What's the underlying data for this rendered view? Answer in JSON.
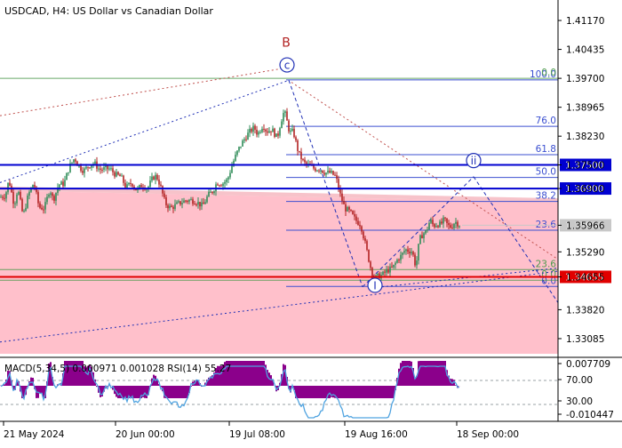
{
  "window": {
    "title": "USDCAD, H4:  US Dollar vs Canadian Dollar"
  },
  "colors": {
    "background": "#ffffff",
    "pink_zone": "#ffc0cb",
    "pink_band": "#f4a9b4",
    "bull_candle": "#2e8b57",
    "bear_candle": "#b22222",
    "wave_blue": "#1f2fb5",
    "fib_blue": "#3b4fd0",
    "fib_green": "#4e9a4e",
    "dotted_red": "#c0504d",
    "level_blue": "#0000d0",
    "level_red": "#e00000",
    "macd_hist": "#8b008b",
    "rsi_line": "#4fa3e0",
    "grid_dash": "#9aa0a6"
  },
  "chart_data": {
    "type": "line",
    "symbol": "USDCAD",
    "timeframe": "H4",
    "title": "USDCAD, H4:  US Dollar vs Canadian Dollar",
    "x_labels": [
      "21 May 2024",
      "20 Jun 00:00",
      "19 Jul 08:00",
      "19 Aug 16:00",
      "18 Sep 00:00"
    ],
    "y_ticks": [
      "1.41170",
      "1.40435",
      "1.39700",
      "1.38965",
      "1.38230",
      "1.37500",
      "1.36900",
      "1.35966",
      "1.35290",
      "1.34655",
      "1.33820",
      "1.33085"
    ],
    "ylim": [
      1.327,
      1.416
    ],
    "price_series": [
      [
        0,
        1.3668
      ],
      [
        6,
        1.3672
      ],
      [
        10,
        1.3712
      ],
      [
        16,
        1.3648
      ],
      [
        20,
        1.369
      ],
      [
        26,
        1.362
      ],
      [
        32,
        1.3675
      ],
      [
        38,
        1.3705
      ],
      [
        44,
        1.3642
      ],
      [
        50,
        1.364
      ],
      [
        56,
        1.369
      ],
      [
        60,
        1.366
      ],
      [
        66,
        1.37
      ],
      [
        72,
        1.3702
      ],
      [
        78,
        1.3745
      ],
      [
        84,
        1.3768
      ],
      [
        88,
        1.3748
      ],
      [
        94,
        1.3735
      ],
      [
        100,
        1.3748
      ],
      [
        106,
        1.3755
      ],
      [
        112,
        1.3738
      ],
      [
        118,
        1.374
      ],
      [
        124,
        1.374
      ],
      [
        130,
        1.3725
      ],
      [
        136,
        1.372
      ],
      [
        142,
        1.3692
      ],
      [
        148,
        1.3705
      ],
      [
        154,
        1.3685
      ],
      [
        160,
        1.37
      ],
      [
        166,
        1.369
      ],
      [
        172,
        1.3718
      ],
      [
        176,
        1.3722
      ],
      [
        180,
        1.37
      ],
      [
        186,
        1.3652
      ],
      [
        192,
        1.364
      ],
      [
        198,
        1.3648
      ],
      [
        204,
        1.3655
      ],
      [
        210,
        1.366
      ],
      [
        216,
        1.366
      ],
      [
        222,
        1.3655
      ],
      [
        228,
        1.3645
      ],
      [
        234,
        1.3672
      ],
      [
        240,
        1.3685
      ],
      [
        244,
        1.3705
      ],
      [
        250,
        1.3702
      ],
      [
        256,
        1.3712
      ],
      [
        262,
        1.3755
      ],
      [
        268,
        1.3788
      ],
      [
        274,
        1.3812
      ],
      [
        280,
        1.3832
      ],
      [
        286,
        1.3845
      ],
      [
        290,
        1.3828
      ],
      [
        296,
        1.3852
      ],
      [
        300,
        1.3835
      ],
      [
        306,
        1.384
      ],
      [
        312,
        1.3818
      ],
      [
        316,
        1.386
      ],
      [
        320,
        1.3888
      ],
      [
        326,
        1.3832
      ],
      [
        330,
        1.3835
      ],
      [
        336,
        1.378
      ],
      [
        342,
        1.3755
      ],
      [
        348,
        1.3748
      ],
      [
        354,
        1.374
      ],
      [
        360,
        1.374
      ],
      [
        366,
        1.373
      ],
      [
        372,
        1.373
      ],
      [
        378,
        1.372
      ],
      [
        382,
        1.368
      ],
      [
        388,
        1.364
      ],
      [
        394,
        1.363
      ],
      [
        400,
        1.361
      ],
      [
        406,
        1.3598
      ],
      [
        410,
        1.356
      ],
      [
        414,
        1.352
      ],
      [
        418,
        1.348
      ],
      [
        422,
        1.3462
      ],
      [
        426,
        1.3468
      ],
      [
        430,
        1.347
      ],
      [
        436,
        1.3482
      ],
      [
        442,
        1.3488
      ],
      [
        448,
        1.3512
      ],
      [
        452,
        1.352
      ],
      [
        456,
        1.3535
      ],
      [
        460,
        1.3532
      ],
      [
        464,
        1.353
      ],
      [
        468,
        1.349
      ],
      [
        472,
        1.356
      ],
      [
        476,
        1.3575
      ],
      [
        480,
        1.3582
      ],
      [
        484,
        1.361
      ],
      [
        488,
        1.3595
      ],
      [
        492,
        1.36
      ],
      [
        496,
        1.3598
      ],
      [
        500,
        1.3612
      ],
      [
        504,
        1.3595
      ],
      [
        508,
        1.3592
      ],
      [
        512,
        1.3606
      ],
      [
        518,
        1.3597
      ]
    ],
    "price_levels": [
      {
        "label": "1.37500",
        "value": 1.375,
        "color": "#0000d0"
      },
      {
        "label": "1.36900",
        "value": 1.369,
        "color": "#0000d0"
      },
      {
        "label": "1.35966",
        "value": 1.35966,
        "color": "#c8c8c8"
      },
      {
        "label": "1.34655",
        "value": 1.34655,
        "color": "#e00000"
      }
    ],
    "fib_retracement": {
      "levels": [
        {
          "label": "100.0",
          "value": 1.3966
        },
        {
          "label": "76.0",
          "value": 1.3848
        },
        {
          "label": "61.8",
          "value": 1.3776
        },
        {
          "label": "50.0",
          "value": 1.3718
        },
        {
          "label": "38.2",
          "value": 1.3657
        },
        {
          "label": "23.6",
          "value": 1.3584
        },
        {
          "label": "0.0",
          "value": 1.3441
        }
      ]
    },
    "fib_expansion": {
      "levels": [
        {
          "label": "23.6",
          "value": 1.3484
        },
        {
          "label": "0.0",
          "value": 1.3457
        },
        {
          "label": "0.0",
          "value": 1.397
        }
      ]
    },
    "wave_labels": [
      {
        "label": "B",
        "x": 322,
        "y": 1.405
      },
      {
        "label": "c",
        "x": 323,
        "y": 1.3995
      },
      {
        "label": "ii",
        "x": 533,
        "y": 1.3752
      },
      {
        "label": "i",
        "x": 422,
        "y": 1.3435
      }
    ],
    "indicator": {
      "label": "MACD(5,34,5) 0.000971 0.001028 RSI(14) 55.27",
      "right_ticks": [
        "0.007709",
        "70.00",
        "30.00",
        "-0.010447"
      ]
    }
  }
}
